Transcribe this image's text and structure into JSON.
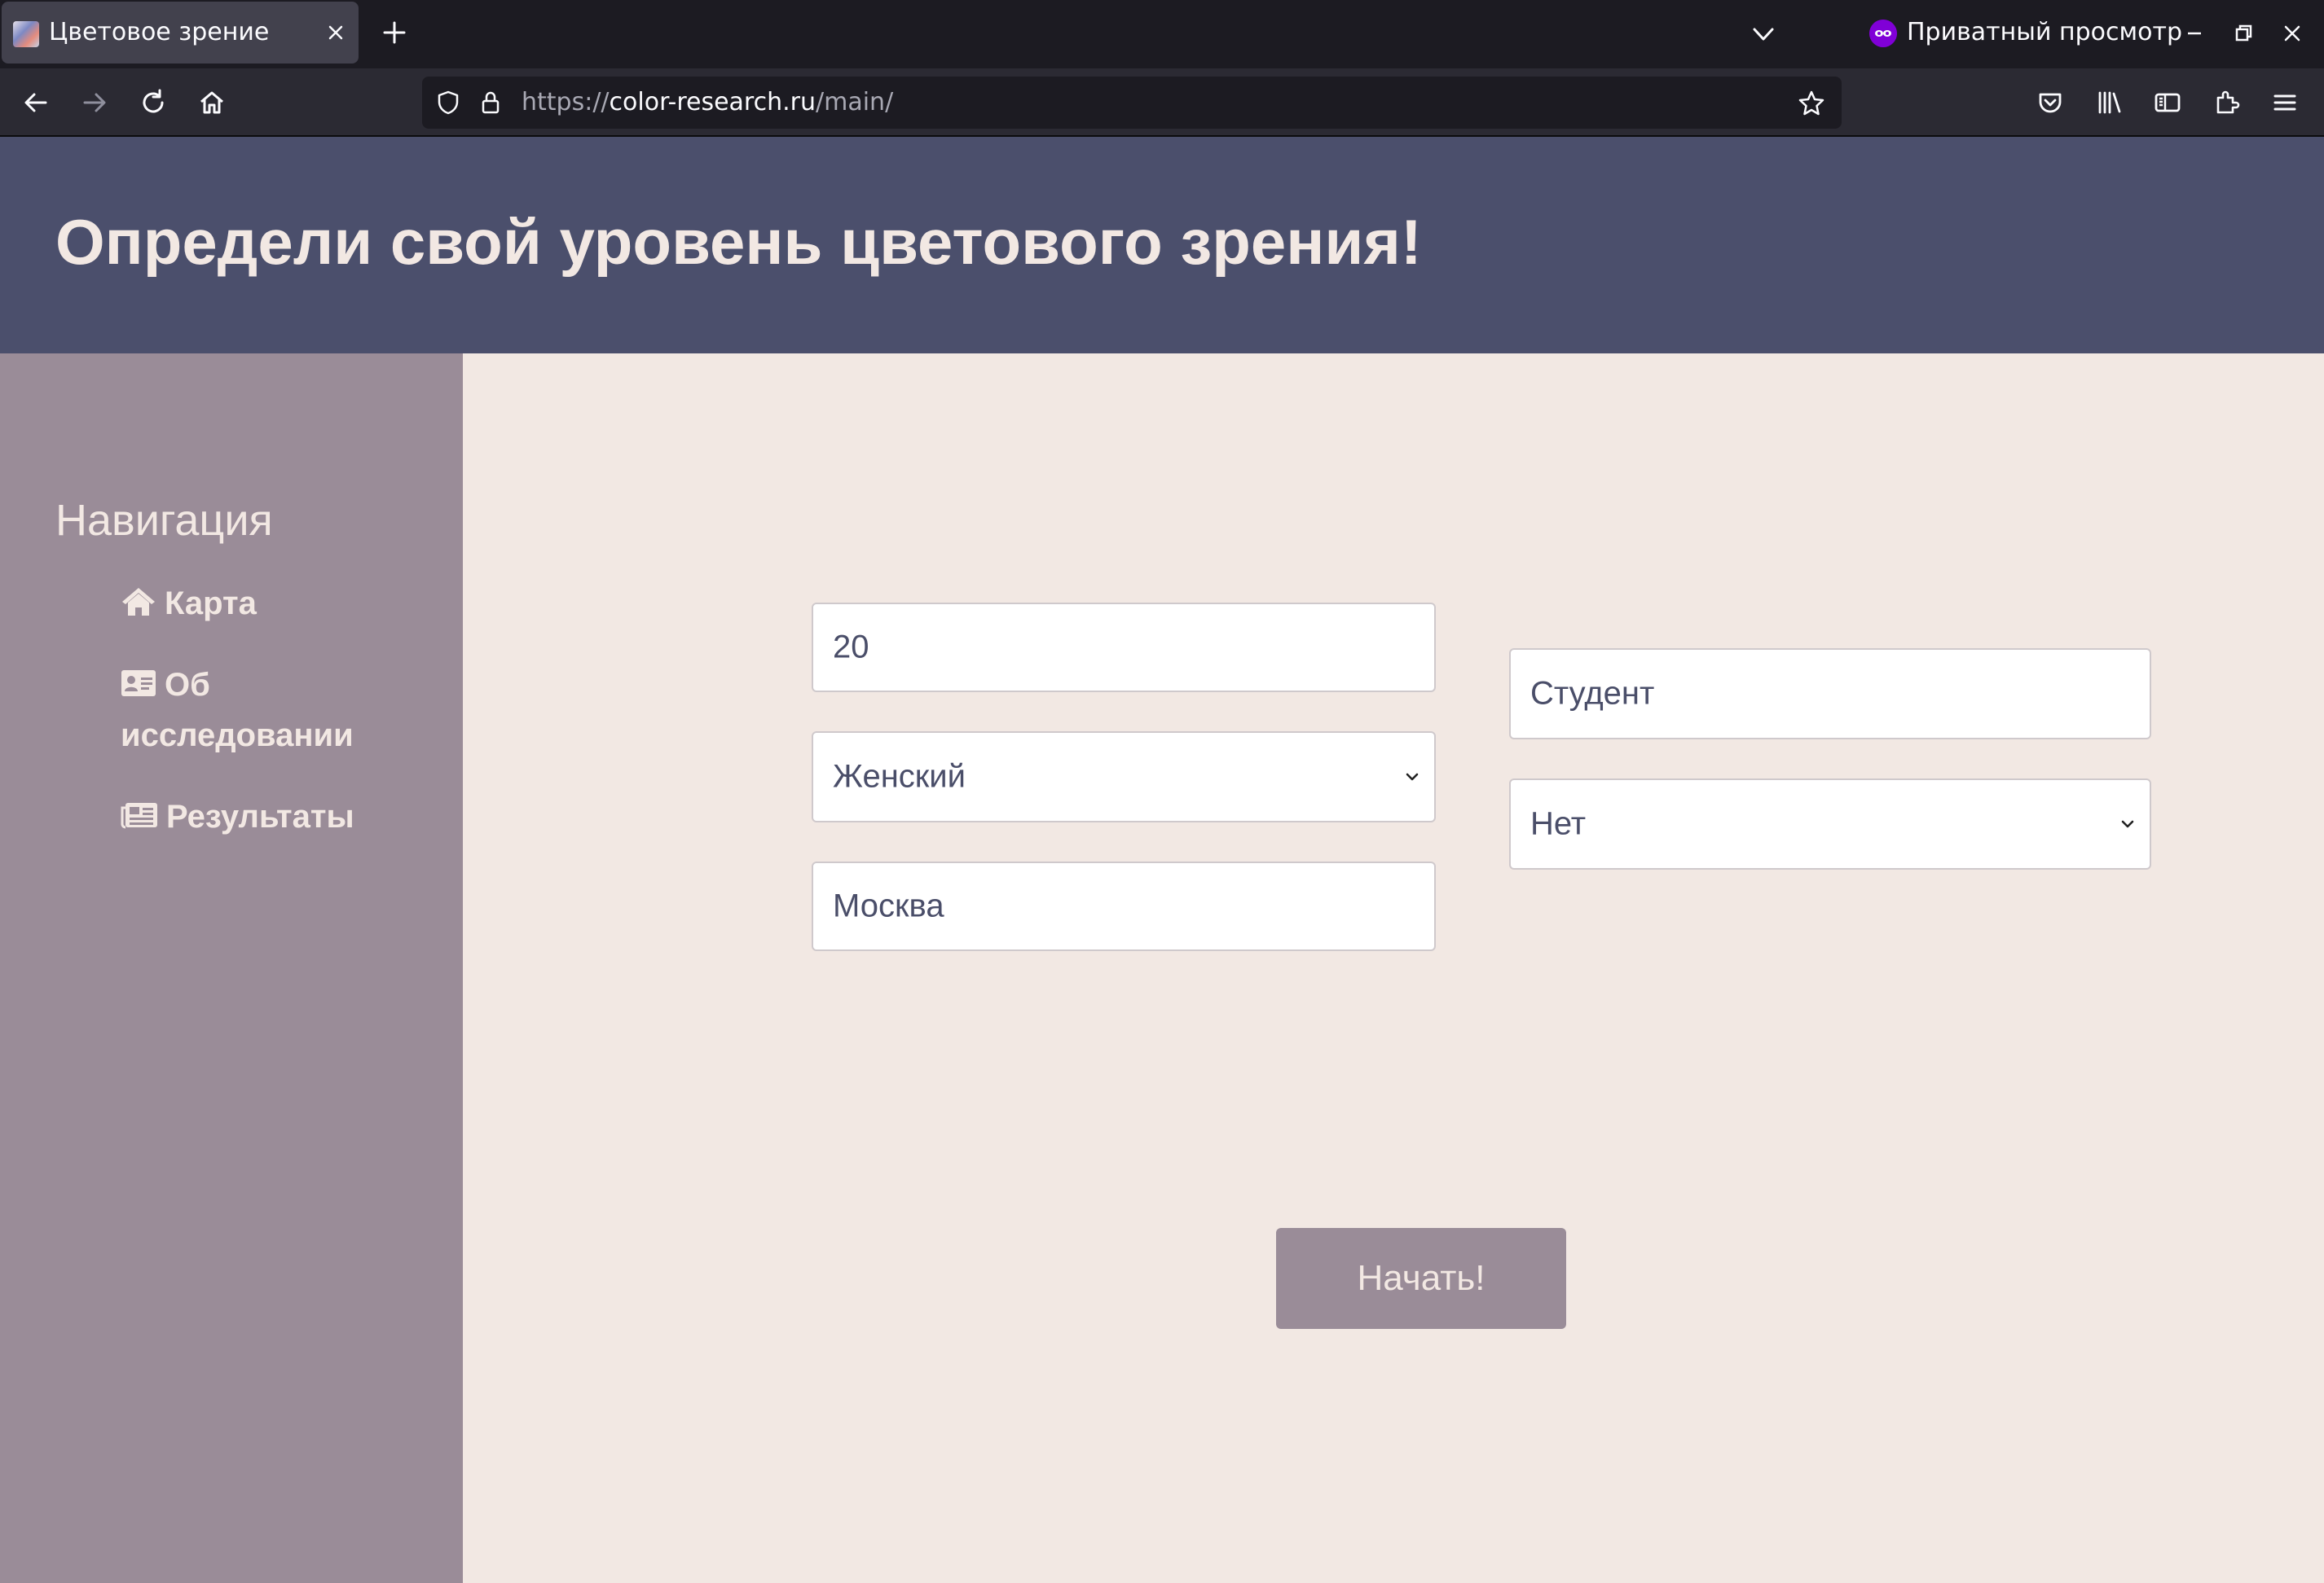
{
  "browser": {
    "tab_title": "Цветовое зрение",
    "private_label": "Приватный просмотр",
    "url": {
      "scheme": "https://",
      "host": "color-research.ru",
      "path": "/main/"
    }
  },
  "page": {
    "title": "Определи свой уровень цветового зрения!"
  },
  "sidebar": {
    "heading": "Навигация",
    "items": [
      {
        "label": "Карта",
        "icon": "home-icon"
      },
      {
        "label_line1": "Об",
        "label_line2": "исследовании",
        "icon": "id-card-icon"
      },
      {
        "label": "Результаты",
        "icon": "newspaper-icon"
      }
    ]
  },
  "form": {
    "age": "20",
    "gender": "Женский",
    "city": "Москва",
    "occupation": "Студент",
    "answer": "Нет",
    "submit_label": "Начать!"
  },
  "colors": {
    "header_bg": "#4b4f6c",
    "sidebar_bg": "#9a8c98",
    "main_bg": "#f2e8e3",
    "button_bg": "#9a8c98",
    "text_light": "#f2e8e3",
    "field_text": "#4a4e69"
  }
}
